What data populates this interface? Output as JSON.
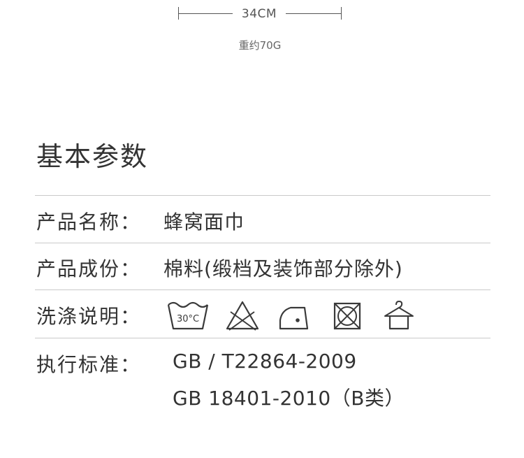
{
  "dimension": {
    "width_label": "34CM",
    "weight_label": "重约70G"
  },
  "section": {
    "title": "基本参数"
  },
  "params": [
    {
      "label": "产品名称：",
      "value": "蜂窝面巾"
    },
    {
      "label": "产品成份：",
      "value": "棉料(缎档及装饰部分除外)"
    },
    {
      "label": "洗涤说明："
    },
    {
      "label": "执行标准：",
      "values": [
        "GB /  T22864-2009",
        "GB  18401-2010（B类）"
      ]
    }
  ],
  "care_icons": [
    {
      "icon": "wash-30c-icon",
      "text": "30°C"
    },
    {
      "icon": "do-not-bleach-icon"
    },
    {
      "icon": "iron-low-icon"
    },
    {
      "icon": "do-not-tumble-dry-icon"
    },
    {
      "icon": "hang-dry-icon"
    }
  ],
  "colors": {
    "text": "#333333",
    "divider": "#c9c9c9",
    "icon_stroke": "#3a3a3a"
  }
}
